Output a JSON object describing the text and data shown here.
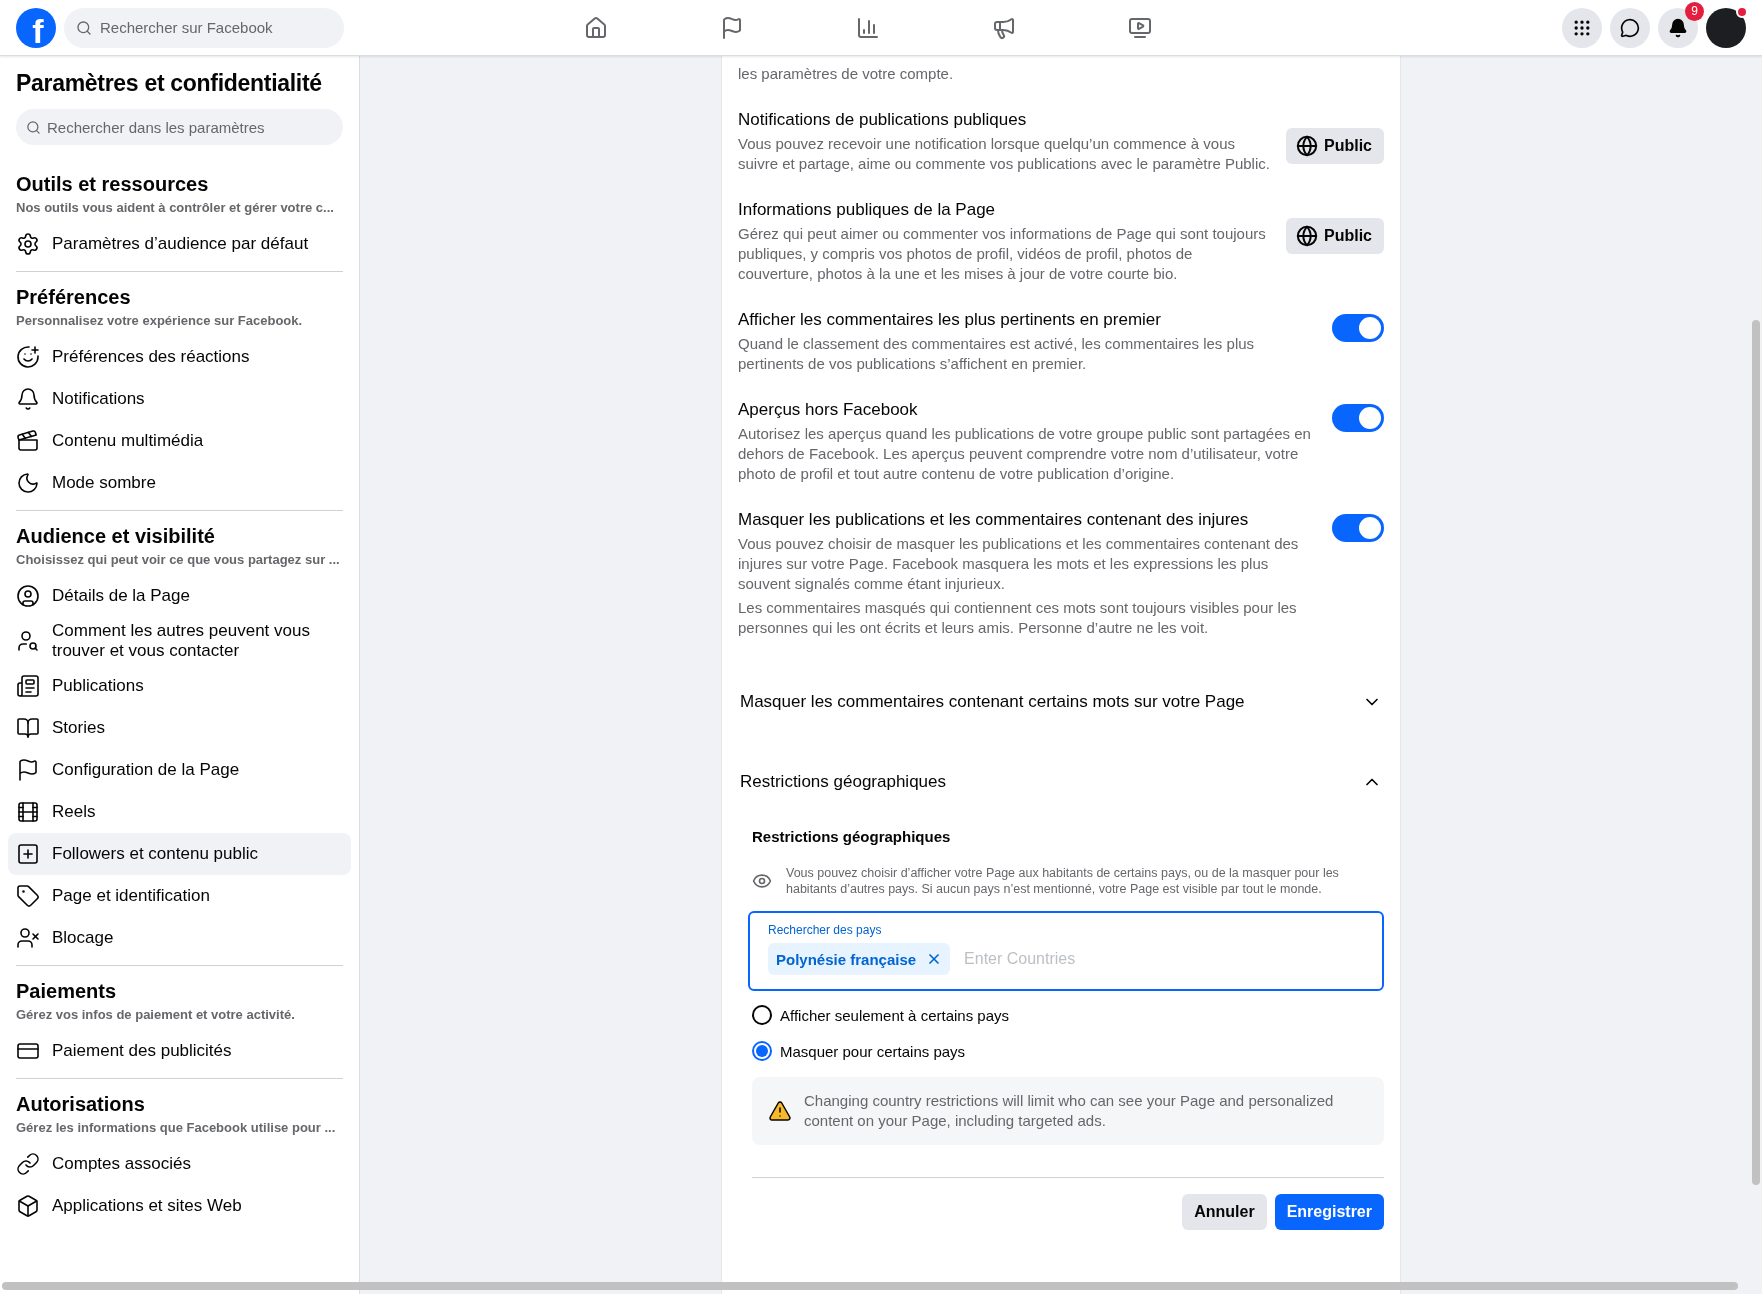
{
  "topbar": {
    "logo": "f",
    "search_placeholder": "Rechercher sur Facebook",
    "notification_badge": "9"
  },
  "sidebar": {
    "title": "Paramètres et confidentialité",
    "search_placeholder": "Rechercher dans les paramètres",
    "sections": [
      {
        "title": "Outils et ressources",
        "subtitle": "Nos outils vous aident à contrôler et gérer votre c...",
        "items": [
          {
            "label": "Paramètres d’audience par défaut",
            "selected": false
          }
        ]
      },
      {
        "title": "Préférences",
        "subtitle": "Personnalisez votre expérience sur Facebook.",
        "items": [
          {
            "label": "Préférences des réactions",
            "selected": false
          },
          {
            "label": "Notifications",
            "selected": false
          },
          {
            "label": "Contenu multimédia",
            "selected": false
          },
          {
            "label": "Mode sombre",
            "selected": false
          }
        ]
      },
      {
        "title": "Audience et visibilité",
        "subtitle": "Choisissez qui peut voir ce que vous partagez sur ...",
        "items": [
          {
            "label": "Détails de la Page",
            "selected": false
          },
          {
            "label": "Comment les autres peuvent vous trouver et vous contacter",
            "selected": false
          },
          {
            "label": "Publications",
            "selected": false
          },
          {
            "label": "Stories",
            "selected": false
          },
          {
            "label": "Configuration de la Page",
            "selected": false
          },
          {
            "label": "Reels",
            "selected": false
          },
          {
            "label": "Followers et contenu public",
            "selected": true
          },
          {
            "label": "Page et identification",
            "selected": false
          },
          {
            "label": "Blocage",
            "selected": false
          }
        ]
      },
      {
        "title": "Paiements",
        "subtitle": "Gérez vos infos de paiement et votre activité.",
        "items": [
          {
            "label": "Paiement des publicités",
            "selected": false
          }
        ]
      },
      {
        "title": "Autorisations",
        "subtitle": "Gérez les informations que Facebook utilise pour ...",
        "items": [
          {
            "label": "Comptes associés",
            "selected": false
          },
          {
            "label": "Applications et sites Web",
            "selected": false
          }
        ]
      }
    ]
  },
  "main": {
    "intro_text": "les paramètres de votre compte.",
    "settings": [
      {
        "kind": "audience",
        "title": "Notifications de publications publiques",
        "description": [
          "Vous pouvez recevoir une notification lorsque quelqu’un commence à vous suivre et partage, aime ou commente vos publications avec le paramètre Public."
        ],
        "button": "Public"
      },
      {
        "kind": "audience",
        "title": "Informations publiques de la Page",
        "description": [
          "Gérez qui peut aimer ou commenter vos informations de Page qui sont toujours publiques, y compris vos photos de profil, vidéos de profil, photos de couverture, photos à la une et les mises à jour de votre courte bio."
        ],
        "button": "Public"
      },
      {
        "kind": "toggle",
        "title": "Afficher les commentaires les plus pertinents en premier",
        "description": [
          "Quand le classement des commentaires est activé, les commentaires les plus pertinents de vos publications s’affichent en premier."
        ],
        "on": true
      },
      {
        "kind": "toggle",
        "title": "Aperçus hors Facebook",
        "description": [
          "Autorisez les aperçus quand les publications de votre groupe public sont partagées en dehors de Facebook. Les aperçus peuvent comprendre votre nom d’utilisateur, votre photo de profil et tout autre contenu de votre publication d’origine."
        ],
        "on": true
      },
      {
        "kind": "toggle",
        "title": "Masquer les publications et les commentaires contenant des injures",
        "description": [
          "Vous pouvez choisir de masquer les publications et les commentaires contenant des injures sur votre Page. Facebook masquera les mots et les expressions les plus souvent signalés comme étant injurieux.",
          "Les commentaires masqués qui contiennent ces mots sont toujours visibles pour les personnes qui les ont écrits et leurs amis. Personne d’autre ne les voit."
        ],
        "on": true
      }
    ],
    "accordions": [
      {
        "title": "Masquer les commentaires contenant certains mots sur votre Page",
        "expanded": false
      },
      {
        "title": "Restrictions géographiques",
        "expanded": true
      }
    ],
    "geo": {
      "heading": "Restrictions géographiques",
      "info": "Vous pouvez choisir d’afficher votre Page aux habitants de certains pays, ou de la masquer pour les habitants d’autres pays. Si aucun pays n’est mentionné, votre Page est visible par tout le monde.",
      "field_label": "Rechercher des pays",
      "chips": [
        "Polynésie française"
      ],
      "placeholder": "Enter Countries",
      "radios": [
        {
          "label": "Afficher seulement à certains pays",
          "selected": false
        },
        {
          "label": "Masquer pour certains pays",
          "selected": true
        }
      ],
      "warning": "Changing country restrictions will limit who can see your Page and personalized content on your Page, including targeted ads.",
      "cancel": "Annuler",
      "save": "Enregistrer"
    }
  }
}
